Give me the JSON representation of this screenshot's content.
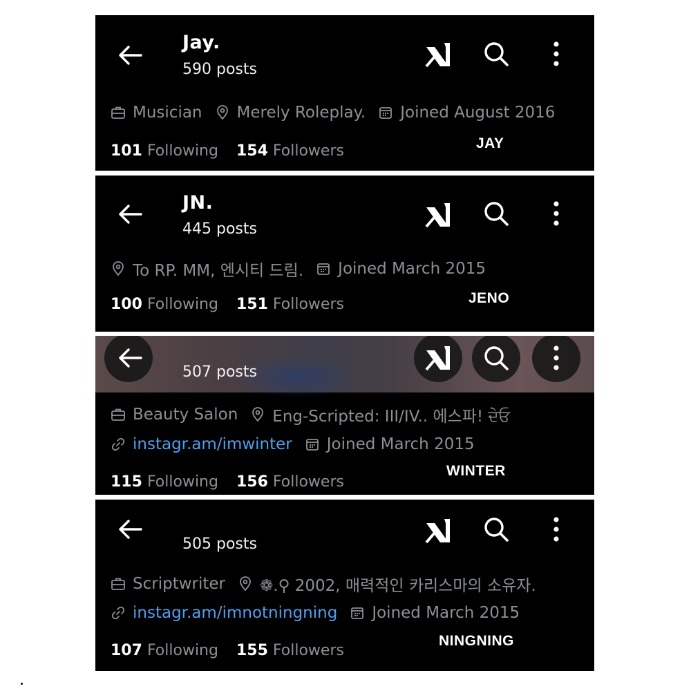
{
  "panels": [
    {
      "name": "Jay.",
      "posts": "590 posts",
      "line1": [
        {
          "icon": "briefcase-icon",
          "text": "Musician"
        },
        {
          "icon": "location-pin-icon",
          "text": "Merely Roleplay."
        },
        {
          "icon": "calendar-icon",
          "text": "Joined August 2016"
        }
      ],
      "following_count": "101",
      "following_label": "Following",
      "followers_count": "154",
      "followers_label": "Followers",
      "tag": "JAY"
    },
    {
      "name": "JN.",
      "posts": "445 posts",
      "line1": [
        {
          "icon": "location-pin-icon",
          "text": "To RP.  MM, 엔시티 드림."
        },
        {
          "icon": "calendar-icon",
          "text": "Joined March 2015"
        }
      ],
      "following_count": "100",
      "following_label": "Following",
      "followers_count": "151",
      "followers_label": "Followers",
      "tag": "JENO"
    },
    {
      "name": "",
      "posts": "507 posts",
      "line1": [
        {
          "icon": "briefcase-icon",
          "text": "Beauty Salon"
        },
        {
          "icon": "location-pin-icon",
          "text": "Eng-Scripted: III/IV.. 에스파! ਦੇਓ"
        }
      ],
      "line2": [
        {
          "icon": "link-icon",
          "text": "instagr.am/imwinter"
        },
        {
          "icon": "calendar-icon",
          "text": "Joined March 2015"
        }
      ],
      "following_count": "115",
      "following_label": "Following",
      "followers_count": "156",
      "followers_label": "Followers",
      "tag": "WINTER"
    },
    {
      "name": "",
      "posts": "505 posts",
      "line1": [
        {
          "icon": "briefcase-icon",
          "text": "Scriptwriter"
        },
        {
          "icon": "location-pin-icon",
          "text": "❁.⚲ 2002, 매력적인 카리스마의 소유자."
        }
      ],
      "line2": [
        {
          "icon": "link-icon",
          "text": "instagr.am/imnotningning"
        },
        {
          "icon": "calendar-icon",
          "text": "Joined March 2015"
        }
      ],
      "following_count": "107",
      "following_label": "Following",
      "followers_count": "155",
      "followers_label": "Followers",
      "tag": "NINGNING"
    }
  ],
  "colors": {
    "background": "#000000",
    "muted_text": "#8b9096",
    "link": "#4f9ff0",
    "page": "#ffffff"
  }
}
